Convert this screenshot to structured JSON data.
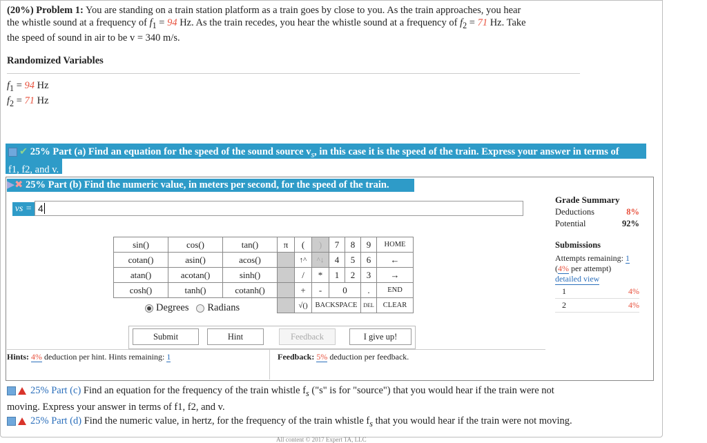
{
  "problem": {
    "header": "(20%) Problem 1:",
    "text1": "You are standing on a train station platform as a train goes by close to you. As the train approaches, you hear",
    "text2a": "the whistle sound at a frequency of ",
    "f1sym": "f",
    "text2b": " = ",
    "f1val": "94",
    "text2c": " Hz. As the train recedes, you hear the whistle sound at a frequency of ",
    "f2val": "71",
    "text2d": " Hz. Take",
    "text3": "the speed of sound in air to be v = 340 m/s."
  },
  "randomized": {
    "title": "Randomized Variables",
    "f1_label": "f",
    "f1_sub": "1",
    "f1_value": "94",
    "f2_label": "f",
    "f2_sub": "2",
    "f2_value": "71",
    "unit": "Hz"
  },
  "part_a": {
    "line1": "25% Part (a)  Find an equation for the speed of the sound source v",
    "line1_sub": "s",
    "line1_end": ", in this case it is the speed of the train. Express your answer in terms of",
    "line2": "f1, f2, and v."
  },
  "part_b": {
    "title": "25% Part (b)  Find the numeric value, in meters per second, for the speed of the train.",
    "answer_label": "vs =",
    "answer_value": "4"
  },
  "grade": {
    "title": "Grade Summary",
    "deductions_label": "Deductions",
    "deductions_value": "8%",
    "potential_label": "Potential",
    "potential_value": "92%"
  },
  "submissions": {
    "title": "Submissions",
    "attempts_label": "Attempts remaining: ",
    "attempts_value": "1",
    "per_attempt_pct": "4%",
    "per_attempt_text": " per attempt)",
    "detailed": "detailed view",
    "rows": [
      {
        "n": "1",
        "pct": "4%"
      },
      {
        "n": "2",
        "pct": "4%"
      }
    ]
  },
  "keypad": {
    "functions": [
      [
        "sin()",
        "cos()",
        "tan()"
      ],
      [
        "cotan()",
        "asin()",
        "acos()"
      ],
      [
        "atan()",
        "acotan()",
        "sinh()"
      ],
      [
        "cosh()",
        "tanh()",
        "cotanh()"
      ]
    ],
    "pi": "π",
    "lparen": "(",
    "rparen": ")",
    "up": "↑^",
    "upv": "^↓",
    "slash": "/",
    "star": "*",
    "plus": "+",
    "minus": "-",
    "sqrt": "√()",
    "digits": [
      "7",
      "8",
      "9",
      "4",
      "5",
      "6",
      "1",
      "2",
      "3",
      "0",
      "."
    ],
    "home": "HOME",
    "left": "←",
    "right": "→",
    "end": "END",
    "backspace": "BACKSPACE",
    "del": "DEL",
    "clear": "CLEAR",
    "degrees": "Degrees",
    "radians": "Radians"
  },
  "buttons": {
    "submit": "Submit",
    "hint": "Hint",
    "feedback": "Feedback",
    "give_up": "I give up!"
  },
  "hints": {
    "label": "Hints: ",
    "pct": "4%",
    "text": " deduction per hint. Hints remaining: ",
    "remaining": "1"
  },
  "feedback": {
    "label": "Feedback: ",
    "pct": "5%",
    "text": " deduction per feedback."
  },
  "part_c": {
    "head": "25% Part (c)",
    "text": "  Find an equation for the frequency of the train whistle f",
    "sub": "s",
    "text2": " (\"s\" is for \"source\") that you would hear if the train were not",
    "line2": "moving. Express your answer in terms of f1, f2, and v."
  },
  "part_d": {
    "head": "25% Part (d)",
    "text": "  Find the numeric value, in hertz, for the frequency of the train whistle f",
    "sub": "s",
    "text2": " that you would hear if the train were not moving."
  },
  "footer": "All content © 2017 Expert TA, LLC"
}
